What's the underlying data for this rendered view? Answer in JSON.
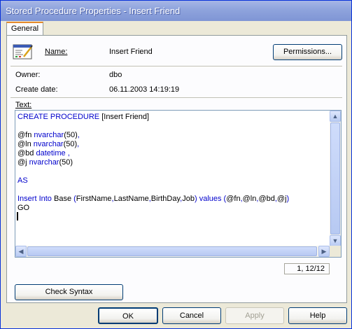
{
  "window": {
    "title": "Stored Procedure Properties - Insert Friend"
  },
  "tabs": [
    {
      "label": "General"
    }
  ],
  "fields": {
    "name_label": "Name:",
    "name_value": "Insert Friend",
    "owner_label": "Owner:",
    "owner_value": "dbo",
    "create_date_label": "Create date:",
    "create_date_value": "06.11.2003 14:19:19",
    "text_label": "Text:"
  },
  "buttons": {
    "permissions": "Permissions...",
    "check_syntax": "Check Syntax",
    "ok": "OK",
    "cancel": "Cancel",
    "apply": "Apply",
    "help": "Help"
  },
  "editor": {
    "lines": [
      [
        {
          "t": "CREATE PROCEDURE ",
          "k": true
        },
        {
          "t": "[Insert Friend]",
          "k": false
        }
      ],
      [],
      [
        {
          "t": "@fn ",
          "k": false
        },
        {
          "t": "nvarchar",
          "k": true
        },
        {
          "t": "(50)",
          "k": false
        },
        {
          "t": ",",
          "k": true
        }
      ],
      [
        {
          "t": "@ln ",
          "k": false
        },
        {
          "t": "nvarchar",
          "k": true
        },
        {
          "t": "(50)",
          "k": false
        },
        {
          "t": ",",
          "k": true
        }
      ],
      [
        {
          "t": "@bd ",
          "k": false
        },
        {
          "t": "datetime",
          "k": true
        },
        {
          "t": " ,",
          "k": true
        }
      ],
      [
        {
          "t": "@j ",
          "k": false
        },
        {
          "t": "nvarchar",
          "k": true
        },
        {
          "t": "(50)",
          "k": false
        }
      ],
      [],
      [
        {
          "t": "AS",
          "k": true
        }
      ],
      [],
      [
        {
          "t": "Insert Into ",
          "k": true
        },
        {
          "t": "Base ",
          "k": false
        },
        {
          "t": "(",
          "k": true
        },
        {
          "t": "FirstName",
          "k": false
        },
        {
          "t": ",",
          "k": true
        },
        {
          "t": "LastName",
          "k": false
        },
        {
          "t": ",",
          "k": true
        },
        {
          "t": "BirthDay",
          "k": false
        },
        {
          "t": ",",
          "k": true
        },
        {
          "t": "Job",
          "k": false
        },
        {
          "t": ") values (",
          "k": true
        },
        {
          "t": "@fn",
          "k": false
        },
        {
          "t": ",",
          "k": true
        },
        {
          "t": "@ln",
          "k": false
        },
        {
          "t": ",",
          "k": true
        },
        {
          "t": "@bd",
          "k": false
        },
        {
          "t": ",",
          "k": true
        },
        {
          "t": "@j",
          "k": false
        },
        {
          "t": ")",
          "k": true
        }
      ],
      [
        {
          "t": "GO",
          "k": false
        }
      ]
    ],
    "cursor_position": "1, 12/12"
  },
  "colors": {
    "keyword": "#0000cc",
    "accent": "#0831d9"
  },
  "icons": {
    "procedure": "stored-procedure-icon"
  }
}
